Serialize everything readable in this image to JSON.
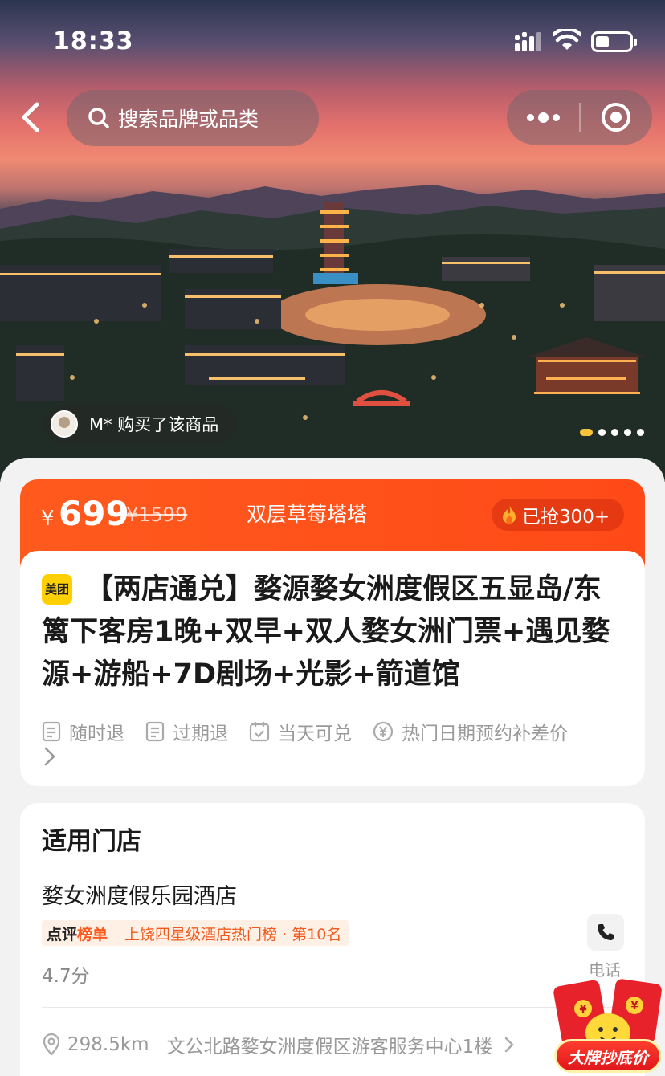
{
  "status_bar": {
    "time": "18:33"
  },
  "nav": {
    "search_placeholder": "搜索品牌或品类"
  },
  "hero": {
    "buyer_toast": "M* 购买了该商品",
    "carousel": {
      "count": 5,
      "active": 0
    }
  },
  "price": {
    "currency": "¥",
    "amount": "699",
    "original": "¥1599",
    "product_name": "双层草莓塔塔",
    "sold": "已抢300+"
  },
  "product": {
    "badge": "美团",
    "title": "【两店通兑】婺源婺女洲度假区五显岛/东篱下客房1晚+双早+双人婺女洲门票+遇见婺源+游船+7D剧场+光影+箭道馆",
    "policies": [
      {
        "icon": "receipt-icon",
        "label": "随时退"
      },
      {
        "icon": "receipt-icon",
        "label": "过期退"
      },
      {
        "icon": "calendar-check-icon",
        "label": "当天可兑"
      },
      {
        "icon": "yen-coin-icon",
        "label": "热门日期预约补差价"
      }
    ]
  },
  "stores": {
    "section_title": "适用门店",
    "name": "婺女洲度假乐园酒店",
    "rank_brand_a": "点评",
    "rank_brand_b": "榜单",
    "rank_text": "上饶四星级酒店热门榜 · 第10名",
    "score": "4.7分",
    "phone_label": "电话",
    "distance": "298.5km",
    "address": "文公北路婺女洲度假区游客服务中心1楼"
  },
  "floating": {
    "redpacket_label": "大牌抄底价"
  },
  "colors": {
    "accent": "#ff4a17",
    "badge_yellow": "#ffd000",
    "rank_orange": "#f05a1e"
  }
}
